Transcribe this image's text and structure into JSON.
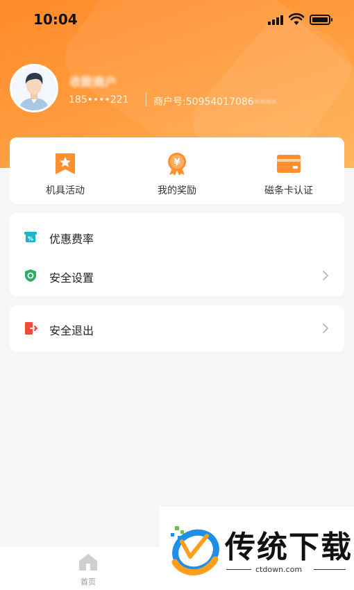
{
  "status_bar": {
    "time": "10:04"
  },
  "profile": {
    "name": "收款商户",
    "phone": "185••••221",
    "merchant_prefix": "商户号:",
    "merchant_no": "50954017086",
    "merchant_suffix": "••••"
  },
  "quick_actions": [
    {
      "label": "机具活动",
      "icon": "ribbon-star-icon"
    },
    {
      "label": "我的奖励",
      "icon": "reward-medal-icon"
    },
    {
      "label": "磁条卡认证",
      "icon": "card-icon"
    }
  ],
  "menu": [
    {
      "label": "优惠费率",
      "icon": "discount-rate-icon"
    },
    {
      "label": "安全设置",
      "icon": "shield-icon"
    }
  ],
  "logout": {
    "label": "安全退出",
    "icon": "logout-door-icon"
  },
  "bottom_nav": {
    "home_label": "首页"
  },
  "watermark": {
    "title": "传统下载",
    "url": "ctdown.com"
  },
  "colors": {
    "accent": "#ff8f2f",
    "shield": "#27ae60",
    "discount": "#1bb5c9",
    "logout": "#f04b3a"
  }
}
